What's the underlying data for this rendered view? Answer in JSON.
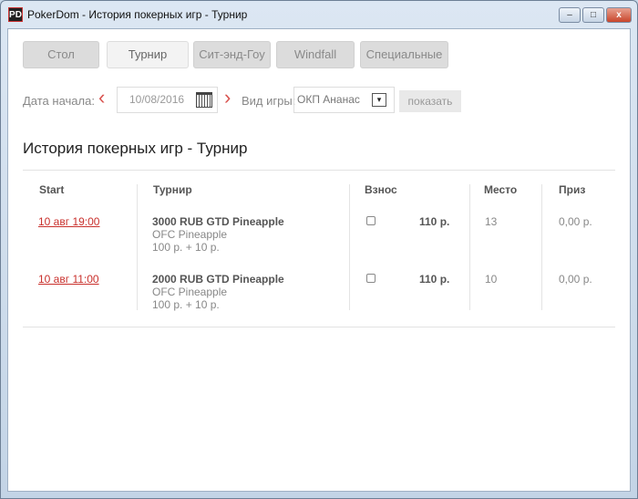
{
  "window": {
    "title": "PokerDom - История покерных игр - Турнир",
    "icon": "PD",
    "min": "–",
    "max": "□",
    "close": "x"
  },
  "tabs": [
    {
      "label": "Стол"
    },
    {
      "label": "Турнир"
    },
    {
      "label": "Сит-энд-Гоу"
    },
    {
      "label": "Windfall"
    },
    {
      "label": "Специальные"
    }
  ],
  "filters": {
    "date_label": "Дата начала:",
    "date_value": "10/08/2016",
    "prev": "‹",
    "next": "›",
    "game_label": "Вид игры:",
    "game_value": "ОКП Ананас",
    "dropdown": "▾",
    "show": "показать"
  },
  "heading": "История покерных игр - Турнир",
  "table": {
    "headers": [
      "Start",
      "Турнир",
      "Взнос",
      "Место",
      "Приз"
    ],
    "rows": [
      {
        "start": "10 авг 19:00",
        "name": "3000 RUB GTD Pineapple",
        "game": "OFC Pineapple",
        "buyin_detail": "100 р. + 10 р.",
        "fee": "110 р.",
        "place": "13",
        "prize": "0,00 р."
      },
      {
        "start": "10 авг 11:00",
        "name": "2000 RUB GTD Pineapple",
        "game": "OFC Pineapple",
        "buyin_detail": "100 р. + 10 р.",
        "fee": "110 р.",
        "place": "10",
        "prize": "0,00 р."
      }
    ]
  }
}
